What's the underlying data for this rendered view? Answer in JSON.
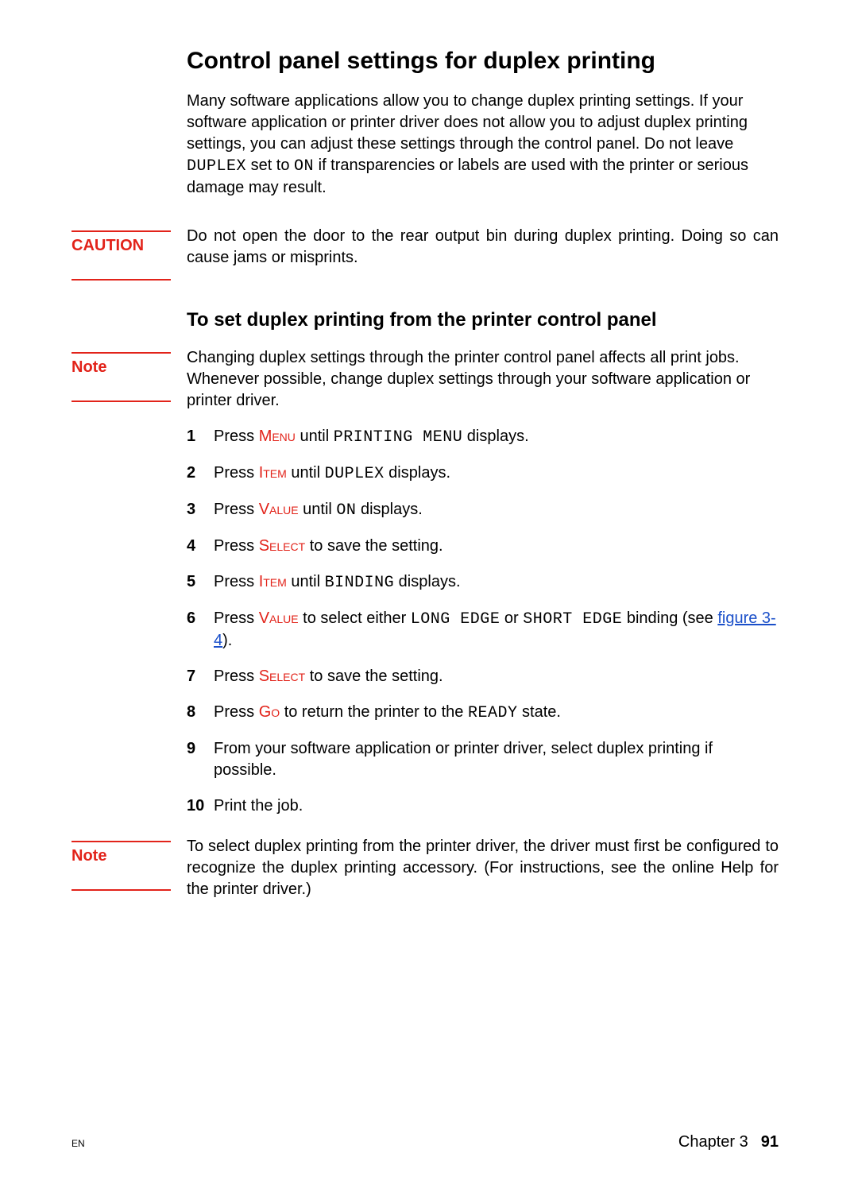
{
  "heading": "Control panel settings for duplex printing",
  "intro_parts": {
    "p1": "Many software applications allow you to change duplex printing settings. If your software application or printer driver does not allow you to adjust duplex printing settings, you can adjust these settings through the control panel. Do not leave ",
    "mono1": "DUPLEX",
    "p2": " set to ",
    "mono2": "ON",
    "p3": " if transparencies or labels are used with the printer or serious damage may result."
  },
  "caution": {
    "label": "CAUTION",
    "text": "Do not open the door to the rear output bin during duplex printing. Doing so can cause jams or misprints."
  },
  "subheading": "To set duplex printing from the printer control panel",
  "note1": {
    "label": "Note",
    "text": "Changing duplex settings through the printer control panel affects all print jobs. Whenever possible, change duplex settings through your software application or printer driver."
  },
  "steps": [
    {
      "n": "1",
      "pre": "Press ",
      "kw": "Menu",
      "mid": " until ",
      "mono": "PRINTING MENU",
      "post": " displays."
    },
    {
      "n": "2",
      "pre": "Press ",
      "kw": "Item",
      "mid": " until ",
      "mono": "DUPLEX",
      "post": " displays."
    },
    {
      "n": "3",
      "pre": "Press ",
      "kw": "Value",
      "mid": " until ",
      "mono": "ON",
      "post": " displays."
    },
    {
      "n": "4",
      "pre": "Press ",
      "kw": "Select",
      "mid": " to save the setting.",
      "mono": "",
      "post": ""
    },
    {
      "n": "5",
      "pre": "Press ",
      "kw": "Item",
      "mid": " until ",
      "mono": "BINDING",
      "post": " displays."
    },
    {
      "n": "6",
      "pre": "Press ",
      "kw": "Value",
      "mid": " to select either ",
      "mono": "LONG EDGE",
      "post_or": " or ",
      "mono2": "SHORT EDGE",
      "post": " binding (see ",
      "link": "figure 3-4",
      "tail": ")."
    },
    {
      "n": "7",
      "pre": "Press ",
      "kw": "Select",
      "mid": " to save the setting.",
      "mono": "",
      "post": ""
    },
    {
      "n": "8",
      "pre": "Press ",
      "kw": "Go",
      "mid": " to return the printer to the ",
      "mono": "READY",
      "post": " state."
    },
    {
      "n": "9",
      "plain": "From your software application or printer driver, select duplex printing if possible."
    },
    {
      "n": "10",
      "plain": "Print the job."
    }
  ],
  "note2": {
    "label": "Note",
    "text": "To select duplex printing from the printer driver, the driver must first be configured to recognize the duplex printing accessory. (For instructions, see the online Help for the printer driver.)"
  },
  "footer": {
    "en": "EN",
    "chapter": "Chapter 3",
    "page": "91"
  }
}
